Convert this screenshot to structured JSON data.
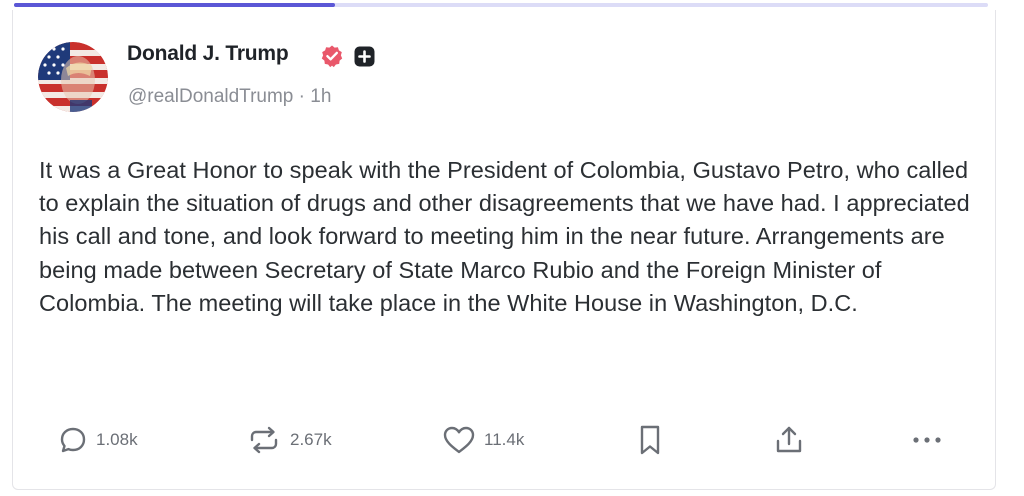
{
  "progress": {
    "fraction": 0.33,
    "fill_color": "#5b57d6",
    "track_color": "#dcdcf7"
  },
  "author": {
    "display_name": "Donald J. Trump",
    "verified_icon": "verified-badge-icon",
    "verified_color": "#e9586b",
    "extra_icon": "plus-square-icon",
    "handle": "@realDonaldTrump",
    "separator": "·",
    "time": "1h",
    "avatar": "avatar-flag-portrait"
  },
  "post": {
    "text": "It was a Great Honor to speak with the President of Colombia, Gustavo Petro, who called to explain the situation of drugs and other disagreements that we have had. I appreciated his call and tone, and look forward to meeting him in the near future. Arrangements are being made between Secretary of State Marco Rubio and the Foreign Minister of Colombia. The meeting will take place in the White House in Washington, D.C."
  },
  "actions": {
    "reply": {
      "icon": "reply-icon",
      "count": "1.08k"
    },
    "repost": {
      "icon": "repost-icon",
      "count": "2.67k"
    },
    "like": {
      "icon": "heart-icon",
      "count": "11.4k"
    },
    "bookmark": {
      "icon": "bookmark-icon"
    },
    "share": {
      "icon": "share-icon"
    },
    "more": {
      "icon": "more-icon"
    }
  },
  "colors": {
    "text": "#2b2f33",
    "muted": "#8a8d94",
    "icon": "#6b6f76"
  }
}
